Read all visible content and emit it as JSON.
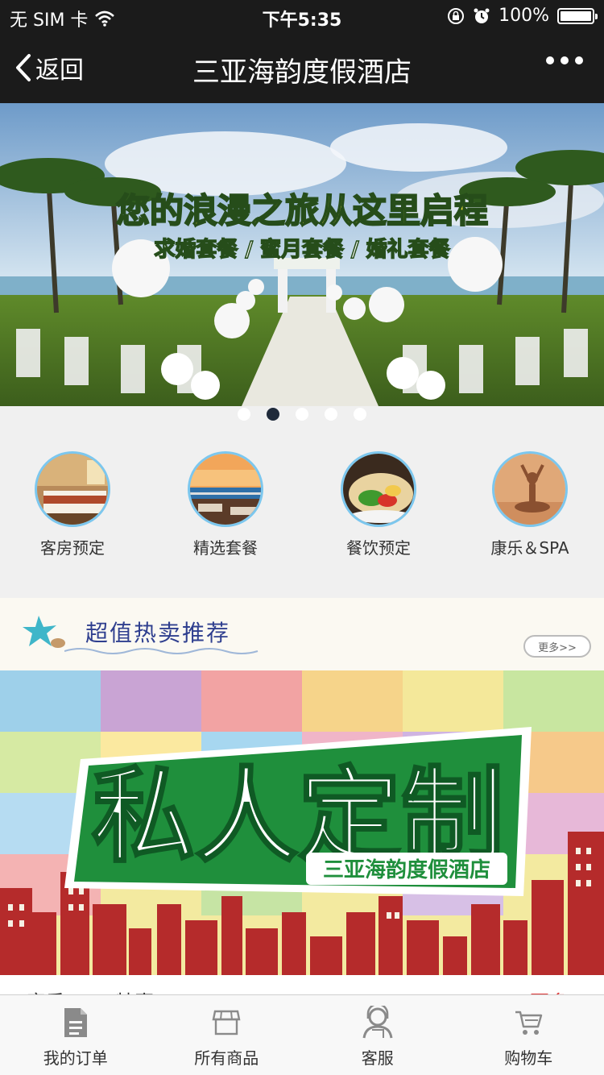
{
  "status_bar": {
    "carrier": "无 SIM 卡",
    "time": "下午5:35",
    "battery": "100%",
    "battery_level": 1.0
  },
  "nav": {
    "back_label": "返回",
    "title": "三亚海韵度假酒店"
  },
  "banner": {
    "headline": "您的浪漫之旅从这里启程",
    "subline": "求婚套餐 / 蜜月套餐 / 婚礼套餐",
    "active_index": 1,
    "slide_count": 5
  },
  "categories": [
    {
      "label": "客房预定",
      "icon": "hotel-room-icon"
    },
    {
      "label": "精选套餐",
      "icon": "sunset-terrace-icon"
    },
    {
      "label": "餐饮预定",
      "icon": "food-wrap-icon"
    },
    {
      "label": "康乐＆SPA",
      "icon": "yoga-spa-icon"
    }
  ],
  "recommend": {
    "title": "超值热卖推荐",
    "more_label": "更多>>"
  },
  "promo": {
    "headline": "私人定制",
    "subline": "三亚海韵度假酒店"
  },
  "section_peek": {
    "title": "康乐&SPA特惠",
    "link": "更多"
  },
  "tabs": [
    {
      "label": "我的订单",
      "icon": "document-icon"
    },
    {
      "label": "所有商品",
      "icon": "store-icon"
    },
    {
      "label": "客服",
      "icon": "customer-service-icon"
    },
    {
      "label": "购物车",
      "icon": "cart-icon"
    }
  ],
  "colors": {
    "nav_bg": "#1b1b1b",
    "accent_blue": "#7cc7ee",
    "promo_green": "#1f8f3c",
    "skyline_red": "#b52b2b"
  }
}
